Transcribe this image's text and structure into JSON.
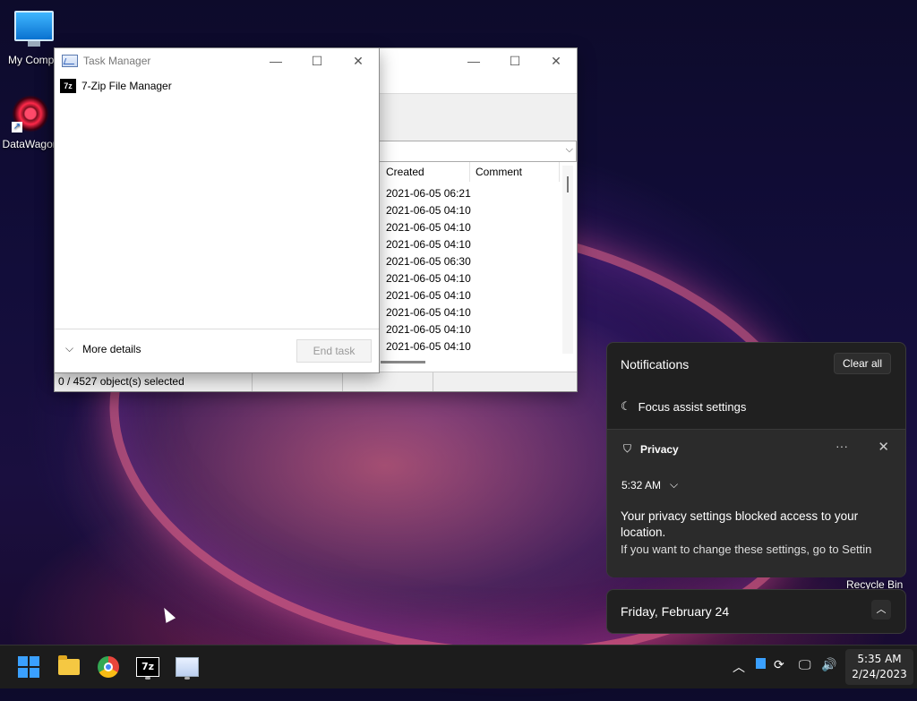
{
  "desktop": {
    "icons": [
      {
        "label": "My Compu"
      },
      {
        "label": "DataWagon"
      }
    ],
    "recycle_bin": "Recycle Bin"
  },
  "sevenzip": {
    "status_text": "0 / 4527 object(s) selected",
    "columns": [
      "Created",
      "Comment"
    ],
    "rows": [
      "2021-06-05 06:21",
      "2021-06-05 04:10",
      "2021-06-05 04:10",
      "2021-06-05 04:10",
      "2021-06-05 06:30",
      "2021-06-05 04:10",
      "2021-06-05 04:10",
      "2021-06-05 04:10",
      "2021-06-05 04:10",
      "2021-06-05 04:10"
    ]
  },
  "taskmgr": {
    "title": "Task Manager",
    "app_name": "7-Zip File Manager",
    "app_icon_text": "7z",
    "more_details": "More details",
    "end_task": "End task"
  },
  "notifications": {
    "header": "Notifications",
    "clear_all": "Clear all",
    "focus_assist": "Focus assist settings",
    "card": {
      "app": "Privacy",
      "time": "5:32 AM",
      "message": "Your privacy settings blocked access to your location.",
      "detail": "If you want to change these settings, go to Settin"
    }
  },
  "date_panel": {
    "date": "Friday, February 24"
  },
  "taskbar": {
    "apps": [
      "start-icon",
      "file-explorer-icon",
      "chrome-icon",
      "7zip-icon",
      "task-manager-icon"
    ],
    "sevenzip_label": "7z",
    "time": "5:35 AM",
    "date": "2/24/2023"
  },
  "colors": {
    "accent": "#3aa0ff",
    "panel_bg": "#202020",
    "taskbar_bg": "#1c1c1c"
  }
}
